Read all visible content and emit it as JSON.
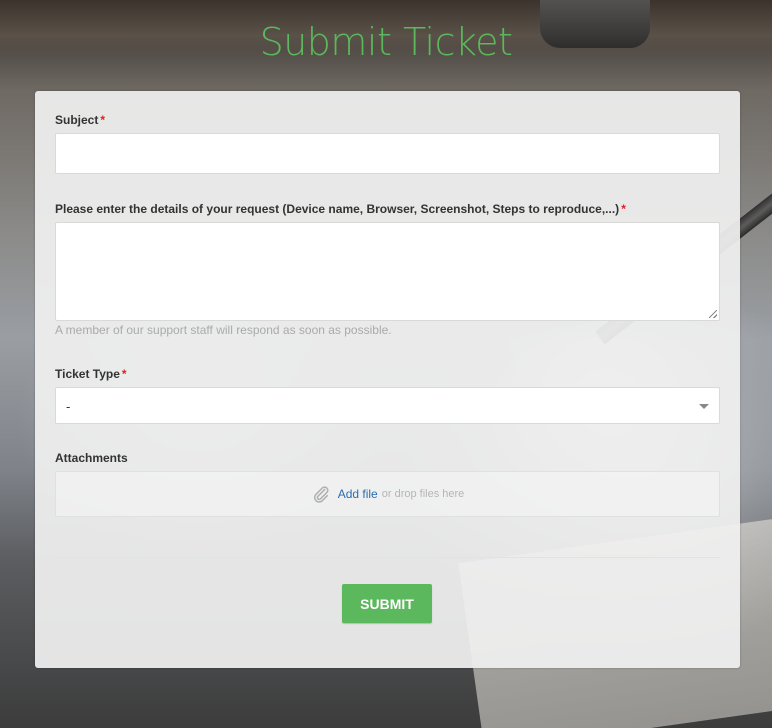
{
  "page": {
    "title": "Submit Ticket"
  },
  "form": {
    "required_marker": "*",
    "subject": {
      "label": "Subject",
      "value": "",
      "placeholder": ""
    },
    "details": {
      "label": "Please enter the details of your request (Device name, Browser, Screenshot, Steps to reproduce,...)",
      "value": "",
      "help_text": "A member of our support staff will respond as soon as possible."
    },
    "ticket_type": {
      "label": "Ticket Type",
      "selected": "-",
      "icon": "chevron-down-icon"
    },
    "attachments": {
      "label": "Attachments",
      "add_file_label": "Add file",
      "drop_text": "or drop files here",
      "icon": "paperclip-icon"
    },
    "submit_label": "SUBMIT"
  },
  "colors": {
    "accent": "#5cb85c",
    "link": "#2a6db0",
    "required": "#e02020"
  }
}
